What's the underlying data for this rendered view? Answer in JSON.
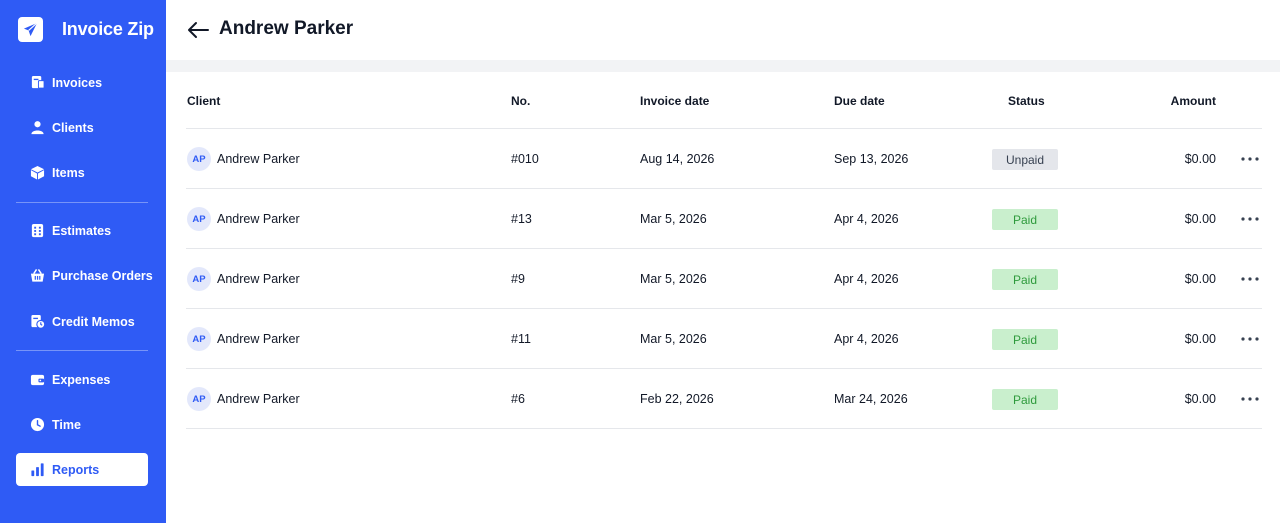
{
  "app": {
    "name": "Invoice Zip",
    "logo_icon": "paper-plane-icon",
    "accent": "#2f5bf5"
  },
  "sidebar": {
    "items": [
      {
        "label": "Invoices",
        "icon": "invoice-icon",
        "active": false
      },
      {
        "label": "Clients",
        "icon": "user-icon",
        "active": false
      },
      {
        "label": "Items",
        "icon": "box-icon",
        "active": false
      },
      {
        "label": "Estimates",
        "icon": "calculator-icon",
        "active": false
      },
      {
        "label": "Purchase Orders",
        "icon": "basket-icon",
        "active": false
      },
      {
        "label": "Credit Memos",
        "icon": "credit-memo-icon",
        "active": false
      },
      {
        "label": "Expenses",
        "icon": "wallet-icon",
        "active": false
      },
      {
        "label": "Time",
        "icon": "clock-icon",
        "active": false
      },
      {
        "label": "Reports",
        "icon": "bar-chart-icon",
        "active": true
      }
    ]
  },
  "header": {
    "title": "Andrew Parker",
    "back_icon": "arrow-left-icon"
  },
  "table": {
    "columns": [
      "Client",
      "No.",
      "Invoice date",
      "Due date",
      "Status",
      "Amount"
    ],
    "rows": [
      {
        "initials": "AP",
        "client": "Andrew Parker",
        "no": "#010",
        "invoice_date": "Aug 14, 2026",
        "due_date": "Sep 13, 2026",
        "status": "Unpaid",
        "amount": "$0.00"
      },
      {
        "initials": "AP",
        "client": "Andrew Parker",
        "no": "#13",
        "invoice_date": "Mar 5, 2026",
        "due_date": "Apr 4, 2026",
        "status": "Paid",
        "amount": "$0.00"
      },
      {
        "initials": "AP",
        "client": "Andrew Parker",
        "no": "#9",
        "invoice_date": "Mar 5, 2026",
        "due_date": "Apr 4, 2026",
        "status": "Paid",
        "amount": "$0.00"
      },
      {
        "initials": "AP",
        "client": "Andrew Parker",
        "no": "#11",
        "invoice_date": "Mar 5, 2026",
        "due_date": "Apr 4, 2026",
        "status": "Paid",
        "amount": "$0.00"
      },
      {
        "initials": "AP",
        "client": "Andrew Parker",
        "no": "#6",
        "invoice_date": "Feb 22, 2026",
        "due_date": "Mar 24, 2026",
        "status": "Paid",
        "amount": "$0.00"
      }
    ],
    "status_colors": {
      "Paid": "#2e9a3c",
      "Unpaid": "#374151"
    },
    "row_action_icon": "more-horizontal-icon"
  }
}
